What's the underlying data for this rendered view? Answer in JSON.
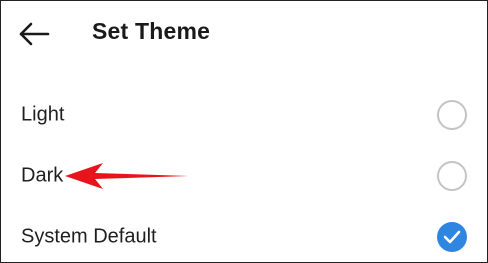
{
  "header": {
    "title": "Set Theme",
    "back_icon": "arrow-left-icon"
  },
  "options": [
    {
      "label": "Light",
      "selected": false
    },
    {
      "label": "Dark",
      "selected": false
    },
    {
      "label": "System Default",
      "selected": true
    }
  ],
  "colors": {
    "accent": "#2f86e0",
    "radio_border": "#c4c4c4",
    "annotation": "#e8141b",
    "text": "#1a1a1a"
  },
  "annotation": {
    "type": "red-arrow",
    "points_to": "Dark"
  }
}
